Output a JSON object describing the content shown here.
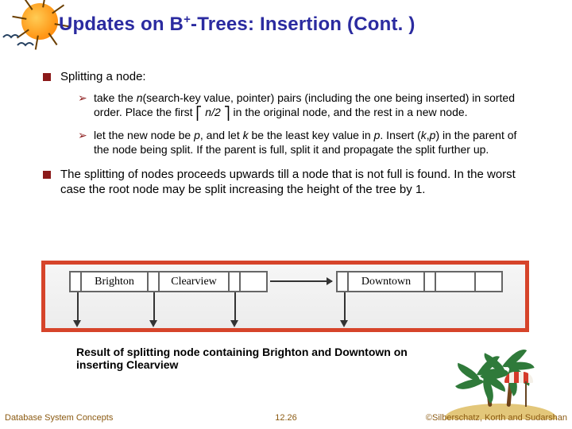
{
  "title_html": "Updates on B<sup>+</sup>-Trees:  Insertion (Cont. )",
  "bullets": {
    "b1": "Splitting a node:",
    "b1a_pre": "take the ",
    "b1a_n": "n",
    "b1a_mid1": "(search-key value, pointer) pairs (including the one being inserted) in sorted order.  Place the first ",
    "ceil_l": "⎡",
    "b1a_frac": "n/2",
    "ceil_r": "⎤",
    "b1a_post": " in the original node, and the rest in a new node.",
    "b1b_pre": "let the new node be ",
    "b1b_p": "p",
    "b1b_mid1": ", and let ",
    "b1b_k": "k",
    "b1b_mid2": " be the least key value in ",
    "b1b_p2": "p",
    "b1b_mid3": ".  Insert (",
    "b1b_k2": "k",
    "b1b_comma": ",",
    "b1b_p3": "p",
    "b1b_mid4": ") in the parent of the node being split. If the parent is full, split it and propagate the split further up.",
    "b2": "The splitting of nodes proceeds upwards till a node that is not full is found.  In the worst case the root node may be split increasing the height of the tree by 1."
  },
  "diagram": {
    "cells_left": [
      "Brighton",
      "Clearview"
    ],
    "cells_right": [
      "Downtown"
    ]
  },
  "caption": "Result of splitting node containing Brighton and Downtown on inserting Clearview",
  "footer": {
    "left": "Database System Concepts",
    "mid": "12.26",
    "right": "©Silberschatz, Korth and Sudarshan"
  }
}
